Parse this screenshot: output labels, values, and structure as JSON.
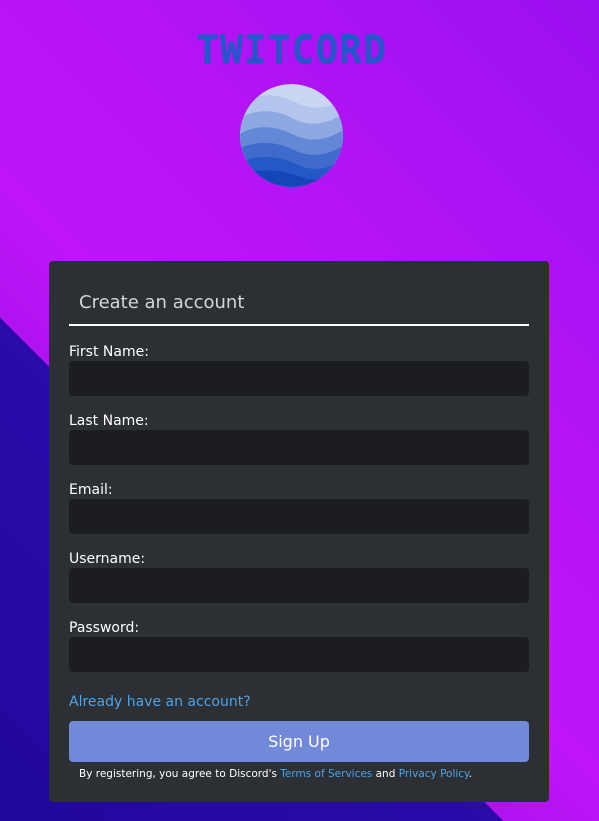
{
  "brand": {
    "name": "TWITCORD"
  },
  "colors": {
    "background_purple": "#bf15f8",
    "background_dark": "#22089c",
    "card": "#2c2f33",
    "input": "#1c1d20",
    "button": "#7289da",
    "link": "#4fa3e8",
    "brand_text": "#2457c9"
  },
  "logo": {
    "icon": "wave-globe-icon"
  },
  "form": {
    "title": "Create an account",
    "fields": [
      {
        "label": "First Name:",
        "value": "",
        "placeholder": ""
      },
      {
        "label": "Last Name:",
        "value": "",
        "placeholder": ""
      },
      {
        "label": "Email:",
        "value": "",
        "placeholder": ""
      },
      {
        "label": "Username:",
        "value": "",
        "placeholder": ""
      },
      {
        "label": "Password:",
        "value": "",
        "placeholder": ""
      }
    ],
    "login_link": "Already have an account?",
    "submit_label": "Sign Up",
    "legal": {
      "prefix": "By registering, you agree to Discord's ",
      "terms": "Terms of Services",
      "middle": " and ",
      "privacy": "Privacy Policy",
      "suffix": "."
    }
  }
}
